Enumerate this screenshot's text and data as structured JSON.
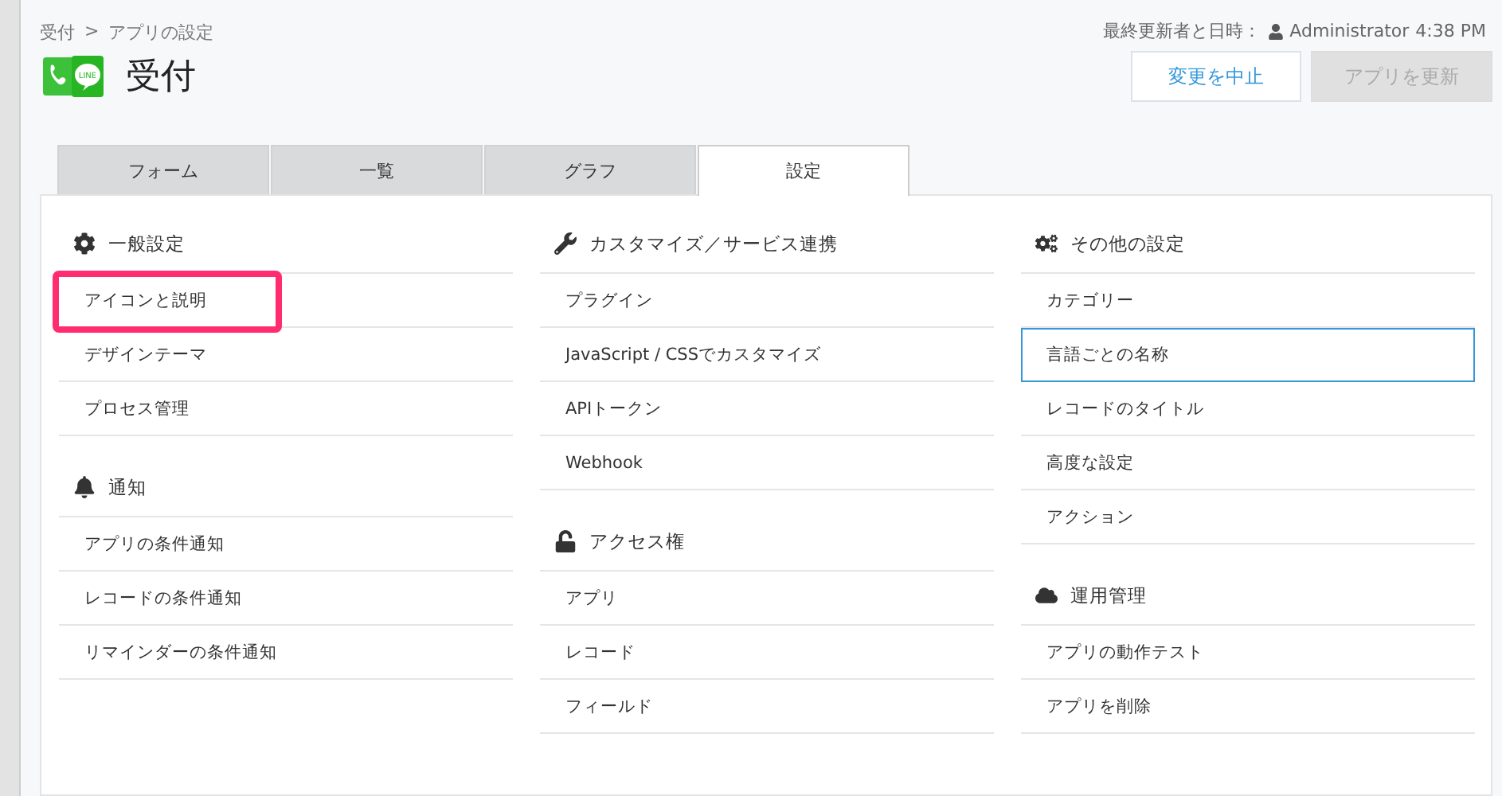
{
  "breadcrumb": {
    "app": "受付",
    "separator": ">",
    "current": "アプリの設定"
  },
  "title": "受付",
  "logo_text": "LINE",
  "last_updated": {
    "label": "最終更新者と日時：",
    "user": "Administrator",
    "time": "4:38 PM"
  },
  "buttons": [
    {
      "label": "変更を中止",
      "disabled": false
    },
    {
      "label": "アプリを更新",
      "disabled": true
    }
  ],
  "tabs": [
    {
      "label": "フォーム",
      "selected": false
    },
    {
      "label": "一覧",
      "selected": false
    },
    {
      "label": "グラフ",
      "selected": false
    },
    {
      "label": "設定",
      "selected": true
    }
  ],
  "columns": [
    {
      "sections": [
        {
          "title": "一般設定",
          "items": [
            {
              "label": "アイコンと説明",
              "highlighted": true,
              "focused": false
            },
            {
              "label": "デザインテーマ",
              "highlighted": false,
              "focused": false
            },
            {
              "label": "プロセス管理",
              "highlighted": false,
              "focused": false
            }
          ]
        },
        {
          "title": "通知",
          "items": [
            {
              "label": "アプリの条件通知",
              "highlighted": false,
              "focused": false
            },
            {
              "label": "レコードの条件通知",
              "highlighted": false,
              "focused": false
            },
            {
              "label": "リマインダーの条件通知",
              "highlighted": false,
              "focused": false
            }
          ]
        }
      ]
    },
    {
      "sections": [
        {
          "title": "カスタマイズ／サービス連携",
          "items": [
            {
              "label": "プラグイン",
              "highlighted": false,
              "focused": false
            },
            {
              "label": "JavaScript / CSSでカスタマイズ",
              "highlighted": false,
              "focused": false
            },
            {
              "label": "APIトークン",
              "highlighted": false,
              "focused": false
            },
            {
              "label": "Webhook",
              "highlighted": false,
              "focused": false
            }
          ]
        },
        {
          "title": "アクセス権",
          "items": [
            {
              "label": "アプリ",
              "highlighted": false,
              "focused": false
            },
            {
              "label": "レコード",
              "highlighted": false,
              "focused": false
            },
            {
              "label": "フィールド",
              "highlighted": false,
              "focused": false
            }
          ]
        }
      ]
    },
    {
      "sections": [
        {
          "title": "その他の設定",
          "items": [
            {
              "label": "カテゴリー",
              "highlighted": false,
              "focused": false
            },
            {
              "label": "言語ごとの名称",
              "highlighted": false,
              "focused": true
            },
            {
              "label": "レコードのタイトル",
              "highlighted": false,
              "focused": false
            },
            {
              "label": "高度な設定",
              "highlighted": false,
              "focused": false
            },
            {
              "label": "アクション",
              "highlighted": false,
              "focused": false
            }
          ]
        },
        {
          "title": "運用管理",
          "items": [
            {
              "label": "アプリの動作テスト",
              "highlighted": false,
              "focused": false
            },
            {
              "label": "アプリを削除",
              "highlighted": false,
              "focused": false
            }
          ]
        }
      ]
    }
  ]
}
